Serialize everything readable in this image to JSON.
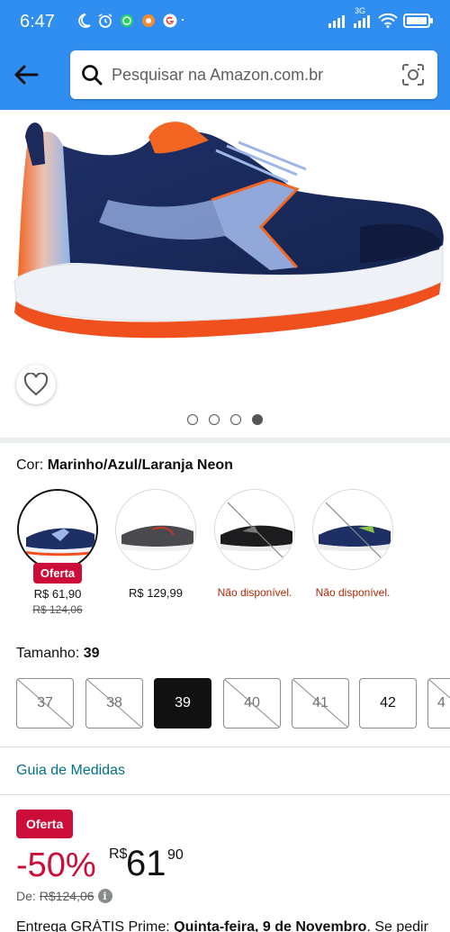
{
  "status_bar": {
    "time": "6:47",
    "dots": "···",
    "network": "3G"
  },
  "header": {
    "search_placeholder": "Pesquisar na Amazon.com.br"
  },
  "gallery": {
    "page_count": 4,
    "active_page": 4
  },
  "color": {
    "label": "Cor:",
    "selected": "Marinho/Azul/Laranja Neon",
    "options": [
      {
        "badge": "Oferta",
        "price": "R$ 61,90",
        "old_price": "R$ 124,06",
        "available": true,
        "selected": true
      },
      {
        "price": "R$ 129,99",
        "available": true,
        "selected": false
      },
      {
        "status": "Não disponível.",
        "available": false,
        "selected": false
      },
      {
        "status": "Não disponível.",
        "available": false,
        "selected": false
      }
    ]
  },
  "size": {
    "label": "Tamanho:",
    "selected": "39",
    "options": [
      {
        "value": "37",
        "available": false
      },
      {
        "value": "38",
        "available": false
      },
      {
        "value": "39",
        "available": true,
        "selected": true
      },
      {
        "value": "40",
        "available": false
      },
      {
        "value": "41",
        "available": false
      },
      {
        "value": "42",
        "available": true
      },
      {
        "value": "4",
        "available": false
      }
    ]
  },
  "size_guide": "Guia de Medidas",
  "price": {
    "badge": "Oferta",
    "discount": "-50%",
    "currency": "R$",
    "whole": "61",
    "cents": "90",
    "list_label": "De:",
    "list_price": "R$124,06"
  },
  "delivery": {
    "prefix": "Entrega GRÁTIS Prime: ",
    "date": "Quinta-feira, 9 de Novembro",
    "suffix": ". Se pedir"
  },
  "colors": {
    "brand_blue": "#2f8eef",
    "deal_red": "#cc0c39",
    "link_teal": "#007185",
    "unavailable_red": "#b12704"
  }
}
